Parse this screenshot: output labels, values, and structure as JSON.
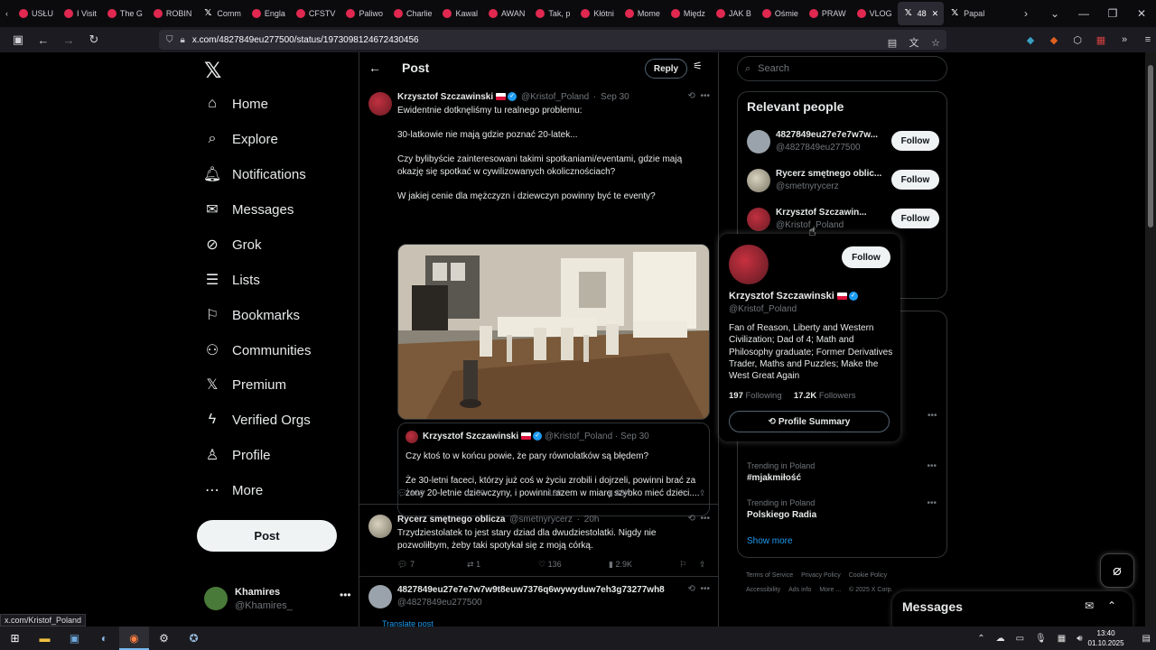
{
  "browser": {
    "tabs": [
      {
        "label": "USŁU",
        "icon": "youtube-favicon"
      },
      {
        "label": "I Visit",
        "icon": "youtube-favicon"
      },
      {
        "label": "The G",
        "icon": "youtube-favicon"
      },
      {
        "label": "ROBIN",
        "icon": "youtube-favicon"
      },
      {
        "label": "Comm",
        "icon": "x-favicon"
      },
      {
        "label": "Engla",
        "icon": "youtube-favicon"
      },
      {
        "label": "CFSTV",
        "icon": "youtube-favicon"
      },
      {
        "label": "Paliwo",
        "icon": "youtube-favicon"
      },
      {
        "label": "Charlie",
        "icon": "youtube-favicon"
      },
      {
        "label": "Kawal",
        "icon": "youtube-favicon"
      },
      {
        "label": "AWAN",
        "icon": "youtube-favicon"
      },
      {
        "label": "Tak, p",
        "icon": "youtube-favicon"
      },
      {
        "label": "Kłótni",
        "icon": "youtube-favicon"
      },
      {
        "label": "Mome",
        "icon": "youtube-favicon"
      },
      {
        "label": "Międz",
        "icon": "youtube-favicon"
      },
      {
        "label": "JAK B",
        "icon": "youtube-favicon"
      },
      {
        "label": "Ośmie",
        "icon": "youtube-favicon"
      },
      {
        "label": "PRAW",
        "icon": "youtube-favicon"
      },
      {
        "label": "VLOG",
        "icon": "youtube-favicon"
      },
      {
        "label": "48",
        "icon": "x-favicon",
        "active": true
      },
      {
        "label": "Papal",
        "icon": "x-favicon"
      }
    ],
    "url": "x.com/4827849eu277500/status/1973098124672430456",
    "status_link": "x.com/Kristof_Poland"
  },
  "nav": {
    "items": [
      {
        "label": "Home",
        "icon": "home-icon"
      },
      {
        "label": "Explore",
        "icon": "search-icon"
      },
      {
        "label": "Notifications",
        "icon": "bell-icon"
      },
      {
        "label": "Messages",
        "icon": "envelope-icon"
      },
      {
        "label": "Grok",
        "icon": "grok-icon"
      },
      {
        "label": "Lists",
        "icon": "list-icon"
      },
      {
        "label": "Bookmarks",
        "icon": "bookmark-icon"
      },
      {
        "label": "Communities",
        "icon": "people-icon"
      },
      {
        "label": "Premium",
        "icon": "x-logo-icon"
      },
      {
        "label": "Verified Orgs",
        "icon": "lightning-icon"
      },
      {
        "label": "Profile",
        "icon": "person-icon"
      },
      {
        "label": "More",
        "icon": "more-circle-icon"
      }
    ],
    "post_label": "Post",
    "account": {
      "name": "Khamires",
      "handle": "@Khamires_"
    }
  },
  "main": {
    "title": "Post",
    "reply_label": "Reply",
    "tweet": {
      "author": "Krzysztof Szczawinski",
      "handle": "@Kristof_Poland",
      "date": "Sep 30",
      "p1": "Ewidentnie dotknęliśmy tu realnego problemu:",
      "p2": "30-latkowie nie mają gdzie poznać 20-latek...",
      "p3": "Czy bylibyście zainteresowani takimi spotkaniami/eventami, gdzie mają okazję się spotkać w cywilizowanych okolicznościach?",
      "p4": "W jakiej cenie dla mężczyzn i dziewczyn powinny być te eventy?",
      "quote": {
        "author": "Krzysztof Szczawinski",
        "handle": "@Kristof_Poland",
        "date": "Sep 30",
        "p1": "Czy ktoś to w końcu powie, że pary równolatków są błędem?",
        "p2": "Że 30-letni faceci, którzy już coś w życiu zrobili i dojrzeli, powinni brać za żony 20-letnie dziewczyny, i powinni razem w miarę szybko mieć dzieci...."
      },
      "stats": {
        "replies": "104",
        "reposts": "39",
        "likes": "160",
        "views": "88K"
      }
    },
    "reply1": {
      "author": "Rycerz smętnego oblicza",
      "handle": "@smetnyrycerz",
      "date": "20h",
      "text": "Trzydziestolatek to jest stary dziad dla dwudziestolatki. Nigdy nie pozwoliłbym, żeby taki spotykał się z moją córką.",
      "stats": {
        "replies": "7",
        "reposts": "1",
        "likes": "136",
        "views": "2.9K"
      }
    },
    "reply2": {
      "author": "4827849eu27e7e7w7w9t8euw7376q6wywyduw7eh3g73277wh8",
      "handle": "@4827849eu277500",
      "translate": "Translate post"
    }
  },
  "right": {
    "search_placeholder": "Search",
    "relevant_title": "Relevant people",
    "people": [
      {
        "name": "4827849eu27e7e7w7w...",
        "handle": "@4827849eu277500",
        "follow": "Follow"
      },
      {
        "name": "Rycerz smętnego oblic...",
        "handle": "@smetnyrycerz",
        "follow": "Follow"
      },
      {
        "name": "Krzysztof Szczawin...",
        "handle": "@Kristof_Poland",
        "follow": "Follow"
      }
    ],
    "trends": [
      {
        "label": "Trending in Poland",
        "title": "#mjakmiłość"
      },
      {
        "label": "Trending in Poland",
        "title": "Polskiego Radia"
      }
    ],
    "show_more": "Show more",
    "footer": [
      "Terms of Service",
      "Privacy Policy",
      "Cookie Policy",
      "Accessibility",
      "Ads info",
      "More ...",
      "© 2025 X Corp."
    ]
  },
  "hovercard": {
    "name": "Krzysztof Szczawinski",
    "handle": "@Kristof_Poland",
    "follow": "Follow",
    "bio": "Fan of Reason, Liberty and Western Civilization; Dad of 4; Math and Philosophy graduate; Former Derivatives Trader, Maths and Puzzles; Make the West Great Again",
    "following_count": "197",
    "following_label": "Following",
    "followers_count": "17.2K",
    "followers_label": "Followers",
    "summary_label": "Profile Summary"
  },
  "messages_dock": {
    "title": "Messages"
  },
  "taskbar": {
    "time": "13:40",
    "date": "01.10.2025"
  },
  "colors": {
    "accent": "#1d9bf0",
    "background": "#000000",
    "border": "#2f3336",
    "muted": "#71767b"
  }
}
